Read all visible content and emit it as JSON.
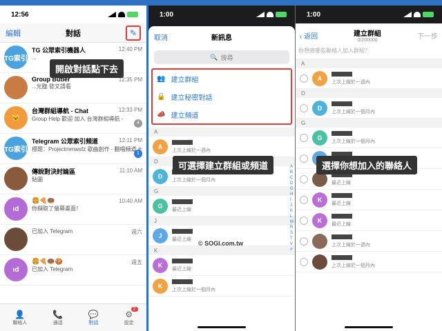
{
  "panel1": {
    "time": "12:56",
    "edit": "編輯",
    "title": "對話",
    "chats": [
      {
        "name": "TG 公眾索引機器人",
        "sub": "...",
        "time": "12:40 PM",
        "color": "#4aa3df",
        "avatar": "TG索引"
      },
      {
        "name": "Group Butler",
        "sub": "...光臨 發文請看",
        "time": "12:35 PM",
        "color": "#c97b44",
        "avatar": "",
        "badge": ""
      },
      {
        "name": "台灣群組導航 - Chat",
        "sub": "Group Help 歡迎 加入 台灣群組導航 -",
        "time": "12:33 PM",
        "color": "#f19a3e",
        "avatar": "🐱",
        "badge": "4"
      },
      {
        "name": "Telegram 公眾索引頻道",
        "sub": "標題：Projectmmwsfz 歌曲創作 - 翻唱頻道 #公開 #頻道 #繁中",
        "time": "12:11 PM",
        "color": "#4aa3df",
        "avatar": "TG索引",
        "badge": "1"
      },
      {
        "name": "傳說對決討論區",
        "sub": "貼圖",
        "time": "11:10 AM",
        "color": "#8a5a3c",
        "avatar": ""
      },
      {
        "name": "🍔🍕🍩",
        "sub": "你擷取了螢幕畫面！",
        "time": "10:40 AM",
        "color": "#b36bd6",
        "avatar": "ıd"
      },
      {
        "name": "",
        "sub": "已加入 Telegram",
        "time": "週六",
        "color": "#6b4c3b",
        "avatar": ""
      },
      {
        "name": "🍔🍕🍩🍪",
        "sub": "已加入 Telegram",
        "time": "週五",
        "color": "#b36bd6",
        "avatar": "ıd"
      }
    ],
    "tabs": [
      {
        "label": "聯絡人",
        "icon": "👤"
      },
      {
        "label": "通話",
        "icon": "📞"
      },
      {
        "label": "對話",
        "icon": "💬"
      },
      {
        "label": "設定",
        "icon": "⚙",
        "badge": "2"
      }
    ],
    "callout": "開啟對話點下去"
  },
  "panel2": {
    "time": "1:00",
    "cancel": "取消",
    "title": "新訊息",
    "search": "搜尋",
    "actions": [
      "建立群組",
      "建立秘密對話",
      "建立頻道"
    ],
    "callout": "可選擇建立群組或頻道",
    "contacts": [
      {
        "section": "A",
        "initial": "A",
        "color": "#f3a243",
        "status": "上次上線於一週內"
      },
      {
        "section": "D",
        "initial": "D",
        "color": "#4fb3d9",
        "status": "上次上線於一個月內"
      },
      {
        "section": "G",
        "initial": "G",
        "color": "#4bc1a4",
        "status": "最近上線"
      },
      {
        "section": "J",
        "initial": "J",
        "color": "#5ca9e6",
        "status": "最近上線"
      },
      {
        "section": "K",
        "initial": "K",
        "color": "#b96fd6",
        "status": "最近上線"
      },
      {
        "section": "",
        "initial": "K",
        "color": "#f3a243",
        "status": "上次上線於一個月內"
      }
    ],
    "watermark": "© SOGI.com.tw",
    "alpha": [
      "A",
      "B",
      "C",
      "D",
      "G",
      "H",
      "I",
      "J",
      "K",
      "L",
      "M",
      "R",
      "S",
      "T",
      "V",
      "#"
    ]
  },
  "panel3": {
    "time": "1:00",
    "back": "返回",
    "title": "建立群組",
    "count": "0/200000",
    "next": "下一步",
    "prompt": "你想將哪些聯絡人加入群組？",
    "callout": "選擇你想加入的聯絡人",
    "contacts": [
      {
        "section": "A",
        "initial": "A",
        "color": "#f3a243",
        "status": "上次上線於一週內"
      },
      {
        "section": "D",
        "initial": "D",
        "color": "#4fb3d9",
        "status": "上次上線於一個月內"
      },
      {
        "section": "G",
        "initial": "G",
        "color": "#4bc1a4",
        "status": "上次上線於一個月內"
      },
      {
        "section": "",
        "initial": "J",
        "color": "#5ca9e6",
        "status": "最近上線"
      },
      {
        "section": "",
        "initial": "",
        "color": "#7a5a48",
        "status": "最近上線"
      },
      {
        "section": "",
        "initial": "K",
        "color": "#b96fd6",
        "status": "最近上線"
      },
      {
        "section": "",
        "initial": "K",
        "color": "#b96fd6",
        "status": "最近上線"
      },
      {
        "section": "",
        "initial": "",
        "color": "#8a6a58",
        "status": "上次上線於一週內"
      },
      {
        "section": "",
        "initial": "",
        "color": "#6b4c3b",
        "status": "上次上線於一個月內"
      }
    ],
    "watermark": "@SOGI.com.tw"
  }
}
